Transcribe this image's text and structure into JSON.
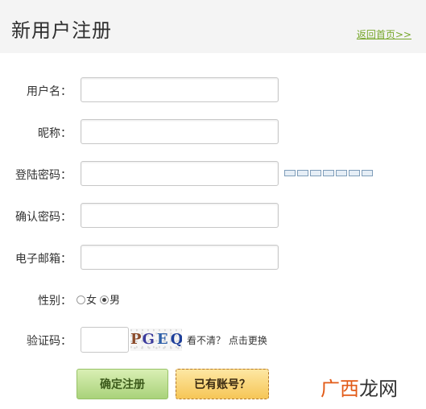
{
  "header": {
    "title": "新用户注册",
    "back_link": "返回首页>>"
  },
  "form": {
    "username_label": "用户名：",
    "nickname_label": "昵称：",
    "password_label": "登陆密码：",
    "confirm_label": "确认密码：",
    "email_label": "电子邮箱：",
    "gender_label": "性别：",
    "gender_female": "女",
    "gender_male": "男",
    "gender_selected": "男",
    "captcha_label": "验证码：",
    "captcha_chars": [
      "P",
      "G",
      "E",
      "Q"
    ],
    "captcha_hint": "看不清？ 点击更换"
  },
  "buttons": {
    "submit": "确定注册",
    "login": "已有账号？"
  },
  "watermark": {
    "part1": "广西",
    "part2": "龙网"
  },
  "colors": {
    "link": "#77a72b",
    "submit_button": "#a9d27a",
    "login_button": "#f6c657",
    "watermark": "#e25b18"
  }
}
